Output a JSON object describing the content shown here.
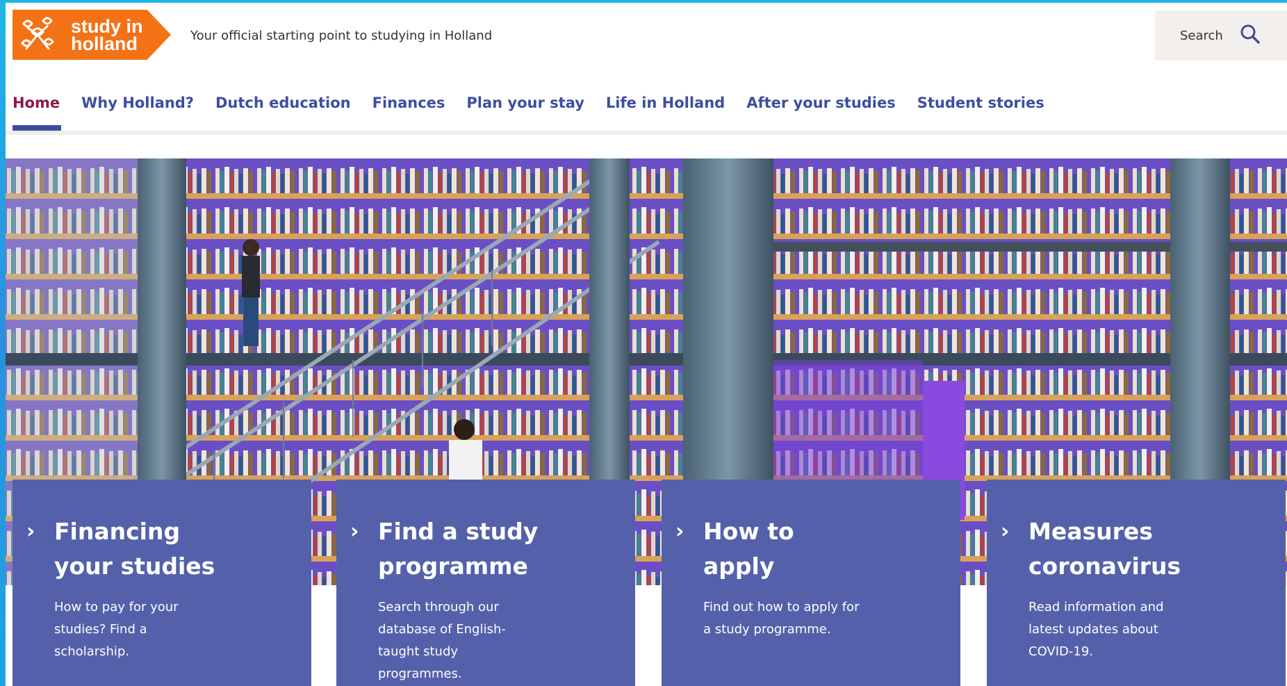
{
  "header": {
    "logo_text_line1": "study in",
    "logo_text_line2": "holland",
    "tagline": "Your official starting point to studying in Holland",
    "search_label": "Search"
  },
  "nav": {
    "items": [
      {
        "label": "Home",
        "active": true
      },
      {
        "label": "Why Holland?"
      },
      {
        "label": "Dutch education"
      },
      {
        "label": "Finances"
      },
      {
        "label": "Plan your stay"
      },
      {
        "label": "Life in Holland"
      },
      {
        "label": "After your studies"
      },
      {
        "label": "Student stories"
      }
    ]
  },
  "cards": [
    {
      "title_line1": "Financing",
      "title_line2": "your studies",
      "description": "How to pay for your studies? Find a scholarship."
    },
    {
      "title_line1": "Find a study",
      "title_line2": "programme",
      "description": "Search through our database of English-taught study programmes."
    },
    {
      "title_line1": "How to",
      "title_line2": "apply",
      "description": "Find out how to apply for a study programme."
    },
    {
      "title_line1": "Measures",
      "title_line2": "coronavirus",
      "description": "Read information and latest updates about COVID-19."
    }
  ],
  "colors": {
    "brand_orange": "#f47216",
    "nav_blue": "#3e4e9e",
    "nav_active": "#8a1a4a",
    "card_blue": "#5461aa"
  }
}
